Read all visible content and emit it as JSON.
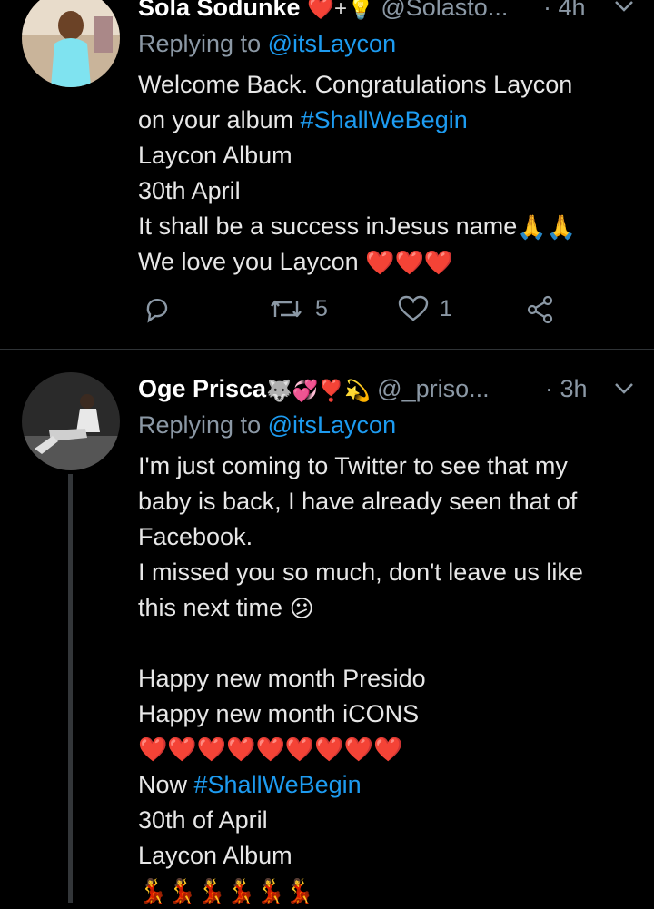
{
  "tweets": [
    {
      "name": "Sola Sodunke",
      "name_emoji": "❤️+💡",
      "handle": "@Solasto...",
      "time": "· 4h",
      "replying_prefix": "Replying to",
      "replying_to": "@itsLaycon",
      "lines": [
        "Welcome Back. Congratulations Laycon",
        "on your album ",
        "Laycon Album",
        "30th April",
        "It shall be a success inJesus name",
        "We love you Laycon"
      ],
      "hashtag": "#ShallWeBegin",
      "pray_emoji": "🙏🙏",
      "love_emoji": "❤️❤️❤️",
      "retweets": "5",
      "likes": "1"
    },
    {
      "name": "Oge Prisca",
      "name_emoji": "🐺💞❣️💫",
      "handle": "@_priso...",
      "time": "· 3h",
      "replying_prefix": "Replying to",
      "replying_to": "@itsLaycon",
      "lines": [
        "I'm just coming to Twitter to see that my",
        "baby is back, I have already seen that of",
        "Facebook.",
        "I missed you so much, don't leave us like",
        "this next time",
        "",
        "Happy new month Presido",
        "Happy new month iCONS",
        "",
        "Now ",
        "30th of April",
        "Laycon Album"
      ],
      "sad_emoji": "😕",
      "heart_row": "❤️❤️❤️❤️❤️❤️❤️❤️❤️",
      "hashtag": "#ShallWeBegin",
      "dancer_row": "💃💃💃💃💃💃"
    }
  ],
  "colors": {
    "background": "#000000",
    "link": "#1d9bf0",
    "muted": "#8b98a5",
    "heart": "#e0457b"
  }
}
